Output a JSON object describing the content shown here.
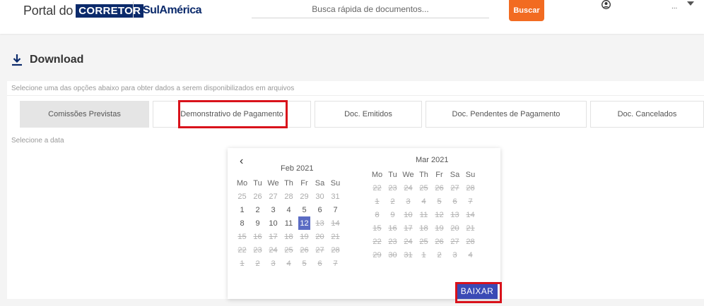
{
  "header": {
    "brand_portal": "Portal do",
    "brand_corretor": "CORRETOR",
    "brand_partner": "SulAmérica",
    "search_placeholder": "Busca rápida de documentos...",
    "search_button": "Buscar",
    "user_name": "...",
    "brand_color": "#0b2a6b",
    "accent_color": "#f26b21"
  },
  "page": {
    "title": "Download",
    "instructions": "Selecione uma das opções abaixo para obter dados a serem disponibilizados em arquivos",
    "date_label": "Selecione a data"
  },
  "tabs": [
    {
      "label": "Comissões Previstas",
      "active": true
    },
    {
      "label": "Demonstrativo de Pagamento",
      "active": false,
      "highlighted": true
    },
    {
      "label": "Doc. Emitidos",
      "active": false
    },
    {
      "label": "Doc. Pendentes de Pagamento",
      "active": false
    },
    {
      "label": "Doc. Cancelados",
      "active": false
    }
  ],
  "datepicker": {
    "prev_icon": "chevron-left-icon",
    "weekdays": [
      "Mo",
      "Tu",
      "We",
      "Th",
      "Fr",
      "Sa",
      "Su"
    ],
    "months": [
      {
        "title": "Feb 2021",
        "days": [
          [
            "25",
            "26",
            "27",
            "28",
            "29",
            "30",
            "31"
          ],
          [
            "1",
            "2",
            "3",
            "4",
            "5",
            "6",
            "7"
          ],
          [
            "8",
            "9",
            "10",
            "11",
            "12",
            "13",
            "14"
          ],
          [
            "15",
            "16",
            "17",
            "18",
            "19",
            "20",
            "21"
          ],
          [
            "22",
            "23",
            "24",
            "25",
            "26",
            "27",
            "28"
          ],
          [
            "1",
            "2",
            "3",
            "4",
            "5",
            "6",
            "7"
          ]
        ],
        "selected_day": "12"
      },
      {
        "title": "Mar 2021",
        "days": [
          [
            "22",
            "23",
            "24",
            "25",
            "26",
            "27",
            "28"
          ],
          [
            "1",
            "2",
            "3",
            "4",
            "5",
            "6",
            "7"
          ],
          [
            "8",
            "9",
            "10",
            "11",
            "12",
            "13",
            "14"
          ],
          [
            "15",
            "16",
            "17",
            "18",
            "19",
            "20",
            "21"
          ],
          [
            "22",
            "23",
            "24",
            "25",
            "26",
            "27",
            "28"
          ],
          [
            "29",
            "30",
            "31",
            "1",
            "2",
            "3",
            "4"
          ]
        ]
      }
    ],
    "download_button": "BAIXAR",
    "selected_color": "#5b6cc4",
    "button_color": "#3a4ab5"
  },
  "highlight_color": "#d9121b"
}
